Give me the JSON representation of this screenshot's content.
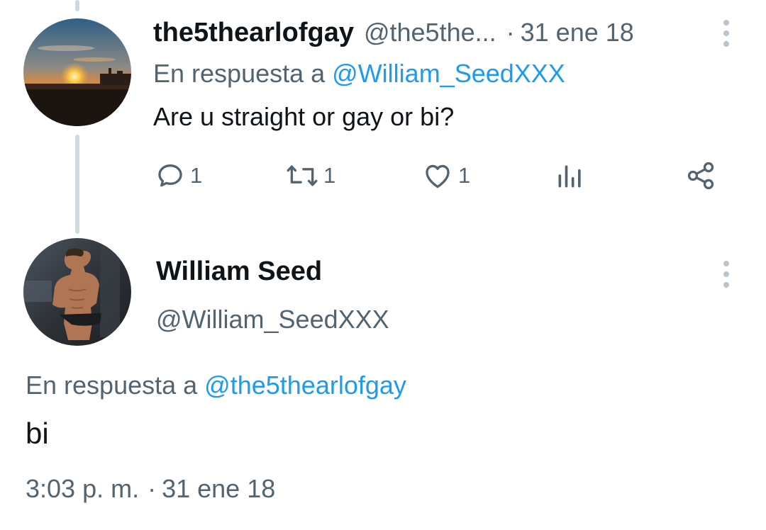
{
  "parent_tweet": {
    "display_name": "the5thearlofgay",
    "handle": "@the5the...",
    "separator": "·",
    "date": "31 ene 18",
    "reply_prefix": "En respuesta a",
    "reply_to": "@William_SeedXXX",
    "text": "Are u straight or gay or bi?",
    "actions": {
      "replies": "1",
      "retweets": "1",
      "likes": "1"
    },
    "avatar_icon": "sunset-avatar"
  },
  "main_tweet": {
    "display_name": "William Seed",
    "handle": "@William_SeedXXX",
    "reply_prefix": "En respuesta a",
    "reply_to": "@the5thearlofgay",
    "text": "bi",
    "time": "3:03 p. m.",
    "separator": "·",
    "date": "31 ene 18",
    "avatar_icon": "person-avatar"
  },
  "colors": {
    "text": "#0f1419",
    "muted": "#536471",
    "link": "#1d9bf0",
    "thread_line": "#cfd9de"
  }
}
